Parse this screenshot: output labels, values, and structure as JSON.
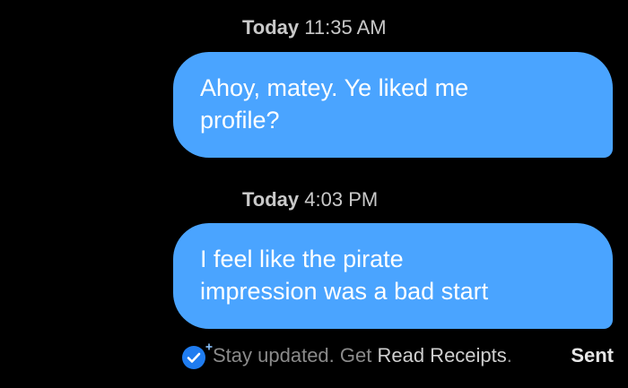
{
  "messages": [
    {
      "day": "Today",
      "time": "11:35 AM",
      "lines": [
        "Ahoy, matey. Ye liked me",
        "profile?"
      ]
    },
    {
      "day": "Today",
      "time": "4:03 PM",
      "lines": [
        "I feel like the pirate",
        "impression was a bad start"
      ]
    }
  ],
  "footer": {
    "prefix": "Stay updated. Get ",
    "link": "Read Receipts",
    "suffix": ".",
    "status": "Sent",
    "icons": [
      "read-receipt-check-icon",
      "plus-icon"
    ]
  },
  "colors": {
    "background": "#000000",
    "bubble": "#4aa4ff",
    "check_badge": "#1f7cf0",
    "timestamp": "#c9c9c9",
    "footer_text": "#8a8a8a"
  }
}
